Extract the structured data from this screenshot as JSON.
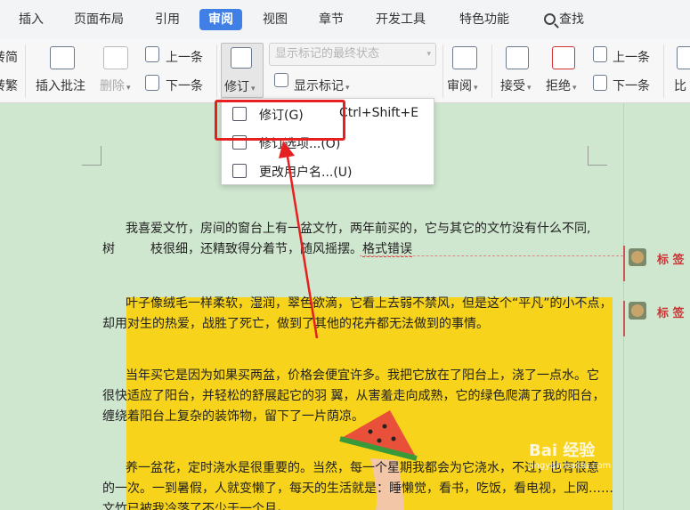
{
  "tabs": [
    {
      "label": "插入",
      "active": false
    },
    {
      "label": "页面布局",
      "active": false
    },
    {
      "label": "引用",
      "active": false
    },
    {
      "label": "审阅",
      "active": true
    },
    {
      "label": "视图",
      "active": false
    },
    {
      "label": "章节",
      "active": false
    },
    {
      "label": "开发工具",
      "active": false
    },
    {
      "label": "特色功能",
      "active": false
    }
  ],
  "search_tab": "查找",
  "ribbon": {
    "left_partial_1": "转简",
    "left_partial_2": "转繁",
    "insert_comment": "插入批注",
    "delete": "删除",
    "prev_item": "上一条",
    "next_item": "下一条",
    "revise": "修订",
    "markup_state": "显示标记的最终状态",
    "show_markup": "显示标记",
    "review": "审阅",
    "accept": "接受",
    "reject": "拒绝",
    "prev_item_2": "上一条",
    "next_item_2": "下一条",
    "compare_partial": "比"
  },
  "menu": {
    "items": [
      {
        "label": "修订(G)",
        "shortcut": "Ctrl+Shift+E"
      },
      {
        "label": "修订选项...(O)",
        "shortcut": ""
      },
      {
        "label": "更改用户名...(U)",
        "shortcut": ""
      }
    ]
  },
  "document": {
    "p1_line1": "我喜爱文竹，房间的窗台上有一盆文竹，两年前买的，它与其它的文竹没有什么不同,",
    "p1_line2_a": "树",
    "p1_line2_b": "枝很细，还精致得分着节，随风摇摆。",
    "p1_err": "格式错误",
    "p2_line1": "叶子像绒毛一样柔软，湿润，翠色欲滴，它看上去弱不禁风，但是这个“平凡”的小不点，",
    "p2_line2": "却用对生的热爱，战胜了死亡，做到了其他的花卉都无法做到的事情。",
    "p3_line1": "当年买它是因为如果买两盆，价格会便宜许多。我把它放在了阳台上，浇了一点水。它",
    "p3_line2": "很快适应了阳台，并轻松的舒展起它的羽  翼，从害羞走向成熟，它的绿色爬满了我的阳台，",
    "p3_line3": "缠绕着阳台上复杂的装饰物，留下了一片荫凉。",
    "p4_line1": "养一盆花，定时浇水是很重要的。当然，每一个星期我都会为它浇水，不过，也有很意",
    "p4_line2": "的一次。一到暑假，人就变懒了，每天的生活就是：睡懒觉，看书，吃饭，看电视，上网……",
    "p4_line3": "文竹已被我冷落了不少于一个月。"
  },
  "comments": [
    {
      "label": "标 签"
    },
    {
      "label": "标 签"
    }
  ],
  "watermark": {
    "main": "Bai 经验",
    "sub": "jingyan.baidu.com"
  },
  "colors": {
    "accent_tab": "#3f7fe6",
    "highlight_box": "#e62020",
    "page_bg": "#cfe6cf",
    "image_bg": "#f7d31c"
  }
}
